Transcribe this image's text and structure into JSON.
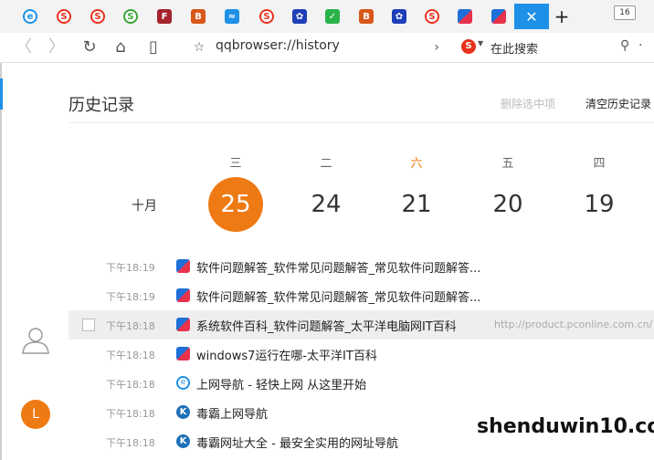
{
  "tabs": [
    {
      "icon": "ie-icon",
      "glyph": "e",
      "color": "#1e90e8"
    },
    {
      "icon": "sogou-icon",
      "glyph": "S",
      "color": "#e8321c"
    },
    {
      "icon": "sogou-icon",
      "glyph": "S",
      "color": "#e8321c"
    },
    {
      "icon": "360-icon",
      "glyph": "S",
      "color": "#3aa335"
    },
    {
      "icon": "fz-icon",
      "glyph": "F",
      "color": "#a5232d"
    },
    {
      "icon": "b-icon",
      "glyph": "B",
      "color": "#d8581a"
    },
    {
      "icon": "stack-icon",
      "glyph": "≈",
      "color": "#1e90e8"
    },
    {
      "icon": "sogou-icon",
      "glyph": "S",
      "color": "#e8321c"
    },
    {
      "icon": "paw-icon",
      "glyph": "✿",
      "color": "#1e3fb8"
    },
    {
      "icon": "shield-icon",
      "glyph": "✓",
      "color": "#2ab34a"
    },
    {
      "icon": "b-icon",
      "glyph": "B",
      "color": "#d8581a"
    },
    {
      "icon": "paw-icon",
      "glyph": "✿",
      "color": "#1e3fb8"
    },
    {
      "icon": "sogou-icon",
      "glyph": "S",
      "color": "#e8321c"
    },
    {
      "icon": "lynx-icon",
      "glyph": "",
      "color": "#1e6fd8"
    },
    {
      "icon": "lynx-icon",
      "glyph": "",
      "color": "#1e6fd8"
    }
  ],
  "tab_count": "16",
  "address_url": "qqbrowser://history",
  "search_placeholder": "在此搜索",
  "page_title": "历史记录",
  "delete_selected": "删除选中项",
  "clear_history": "清空历史记录",
  "month_label": "十月",
  "calendar": [
    {
      "weekday": "三",
      "day": "25",
      "selected": true
    },
    {
      "weekday": "二",
      "day": "24",
      "selected": false
    },
    {
      "weekday": "六",
      "day": "21",
      "selected": false
    },
    {
      "weekday": "五",
      "day": "20",
      "selected": false
    },
    {
      "weekday": "四",
      "day": "19",
      "selected": false
    }
  ],
  "history": [
    {
      "time": "下午18:19",
      "fav": "lynx",
      "title": "软件问题解答_软件常见问题解答_常见软件问题解答...",
      "url": "",
      "highlight": false
    },
    {
      "time": "下午18:19",
      "fav": "lynx",
      "title": "软件问题解答_软件常见问题解答_常见软件问题解答...",
      "url": "",
      "highlight": false
    },
    {
      "time": "下午18:18",
      "fav": "lynx",
      "title": "系统软件百科_软件问题解答_太平洋电脑网IT百科",
      "url": "http://product.pconline.com.cn/",
      "highlight": true
    },
    {
      "time": "下午18:18",
      "fav": "lynx",
      "title": "windows7运行在哪-太平洋IT百科",
      "url": "",
      "highlight": false
    },
    {
      "time": "下午18:18",
      "fav": "ie",
      "title": "上网导航 - 轻快上网 从这里开始",
      "url": "",
      "highlight": false
    },
    {
      "time": "下午18:18",
      "fav": "k",
      "title": "毒霸上网导航",
      "url": "",
      "highlight": false
    },
    {
      "time": "下午18:18",
      "fav": "k",
      "title": "毒霸网址大全 - 最安全实用的网址导航",
      "url": "",
      "highlight": false
    }
  ],
  "user_initial": "L",
  "watermark": "shenduwin10.com"
}
